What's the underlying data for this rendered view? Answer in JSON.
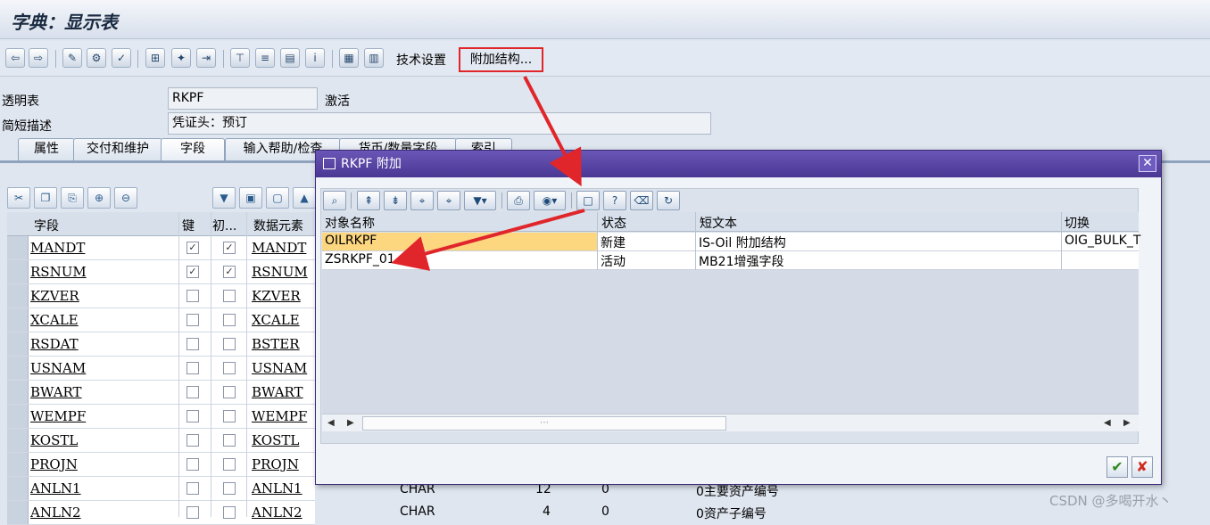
{
  "window": {
    "title": "字典：显示表"
  },
  "toolbar": {
    "tech_settings": "技术设置",
    "append_structure": "附加结构..."
  },
  "form": {
    "table_label": "透明表",
    "table_value": "RKPF",
    "status": "激活",
    "desc_label": "简短描述",
    "desc_value": "凭证头：预订"
  },
  "tabs": [
    "属性",
    "交付和维护",
    "字段",
    "输入帮助/检查",
    "货币/数量字段",
    "索引"
  ],
  "field_table": {
    "headers": {
      "field": "字段",
      "key": "键",
      "init": "初...",
      "data_element": "数据元素"
    },
    "rows": [
      {
        "field": "MANDT",
        "key": true,
        "init": true,
        "element": "MANDT"
      },
      {
        "field": "RSNUM",
        "key": true,
        "init": true,
        "element": "RSNUM"
      },
      {
        "field": "KZVER",
        "key": false,
        "init": false,
        "element": "KZVER"
      },
      {
        "field": "XCALE",
        "key": false,
        "init": false,
        "element": "XCALE"
      },
      {
        "field": "RSDAT",
        "key": false,
        "init": false,
        "element": "BSTER"
      },
      {
        "field": "USNAM",
        "key": false,
        "init": false,
        "element": "USNAM"
      },
      {
        "field": "BWART",
        "key": false,
        "init": false,
        "element": "BWART"
      },
      {
        "field": "WEMPF",
        "key": false,
        "init": false,
        "element": "WEMPF"
      },
      {
        "field": "KOSTL",
        "key": false,
        "init": false,
        "element": "KOSTL"
      },
      {
        "field": "PROJN",
        "key": false,
        "init": false,
        "element": "PROJN"
      },
      {
        "field": "ANLN1",
        "key": false,
        "init": false,
        "element": "ANLN1"
      },
      {
        "field": "ANLN2",
        "key": false,
        "init": false,
        "element": "ANLN2"
      }
    ],
    "partial": [
      {
        "type": "CHAR",
        "len": "12",
        "dec": "0",
        "desc": "0主要资产编号"
      },
      {
        "type": "CHAR",
        "len": "4",
        "dec": "0",
        "desc": "0资产子编号"
      }
    ]
  },
  "dialog": {
    "title": "RKPF 附加",
    "headers": {
      "name": "对象名称",
      "status": "状态",
      "short_text": "短文本",
      "switch": "切换"
    },
    "rows": [
      {
        "name": "OILRKPF",
        "status": "新建",
        "short_text": "IS-Oil 附加结构",
        "switch": "OIG_BULK_T"
      },
      {
        "name": "ZSRKPF_01",
        "status": "活动",
        "short_text": "MB21增强字段",
        "switch": ""
      }
    ],
    "selected_color": "#fdd680"
  },
  "watermark": "CSDN @多喝开水丶",
  "colors": {
    "dialog_title": "#4a3693",
    "annotation": "#e0262b"
  }
}
